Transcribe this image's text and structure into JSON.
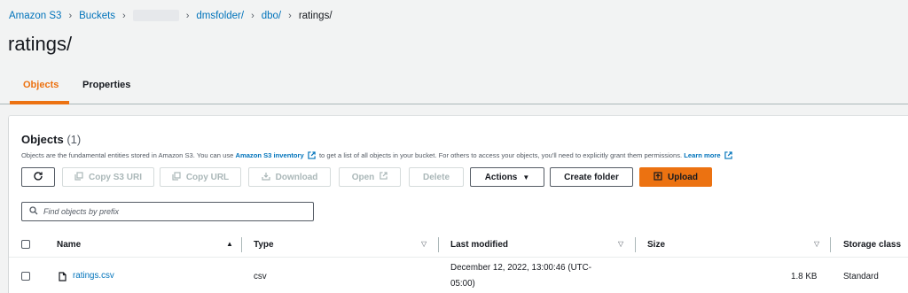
{
  "breadcrumb": {
    "items": [
      "Amazon S3",
      "Buckets",
      "dmsfolder/",
      "dbo/",
      "ratings/"
    ]
  },
  "page": {
    "title": "ratings/"
  },
  "tabs": [
    {
      "label": "Objects",
      "active": true
    },
    {
      "label": "Properties",
      "active": false
    }
  ],
  "objects_panel": {
    "heading": "Objects",
    "count": "(1)",
    "description_pre": "Objects are the fundamental entities stored in Amazon S3. You can use ",
    "inventory_link": "Amazon S3 inventory",
    "description_mid": " to get a list of all objects in your bucket. For others to access your objects, you'll need to explicitly grant them permissions. ",
    "learn_more": "Learn more"
  },
  "toolbar": {
    "refresh_icon": "refresh-icon",
    "copy_s3_uri": "Copy S3 URI",
    "copy_url": "Copy URL",
    "download": "Download",
    "open": "Open",
    "delete": "Delete",
    "actions": "Actions",
    "create_folder": "Create folder",
    "upload": "Upload"
  },
  "search": {
    "placeholder": "Find objects by prefix"
  },
  "table": {
    "columns": [
      "Name",
      "Type",
      "Last modified",
      "Size",
      "Storage class"
    ],
    "rows": [
      {
        "name": "ratings.csv",
        "type": "csv",
        "last_modified_line1": "December 12, 2022, 13:00:46 (UTC-",
        "last_modified_line2": "05:00)",
        "size": "1.8 KB",
        "storage_class": "Standard"
      }
    ]
  },
  "colors": {
    "accent": "#ec7211",
    "link": "#0073bb",
    "text": "#16191f",
    "muted": "#545b64",
    "disabled": "#aab7b8"
  }
}
